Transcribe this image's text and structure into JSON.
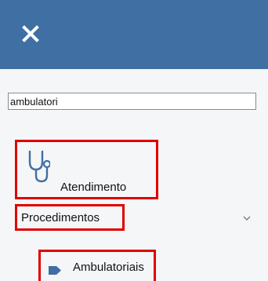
{
  "header": {
    "close_icon": "close-icon",
    "accent_color": "#3f6fa3"
  },
  "search": {
    "value": "ambulatori",
    "placeholder": ""
  },
  "menu": {
    "items": [
      {
        "label": "Atendimento",
        "icon": "stethoscope-icon",
        "highlighted": true
      },
      {
        "label": "Procedimentos",
        "icon": "chevron-down-icon",
        "expanded": true,
        "highlighted": true,
        "children": [
          {
            "label": "Ambulatoriais",
            "icon": "tag-icon",
            "highlighted": true
          }
        ]
      }
    ],
    "highlight_color": "#e00000"
  }
}
